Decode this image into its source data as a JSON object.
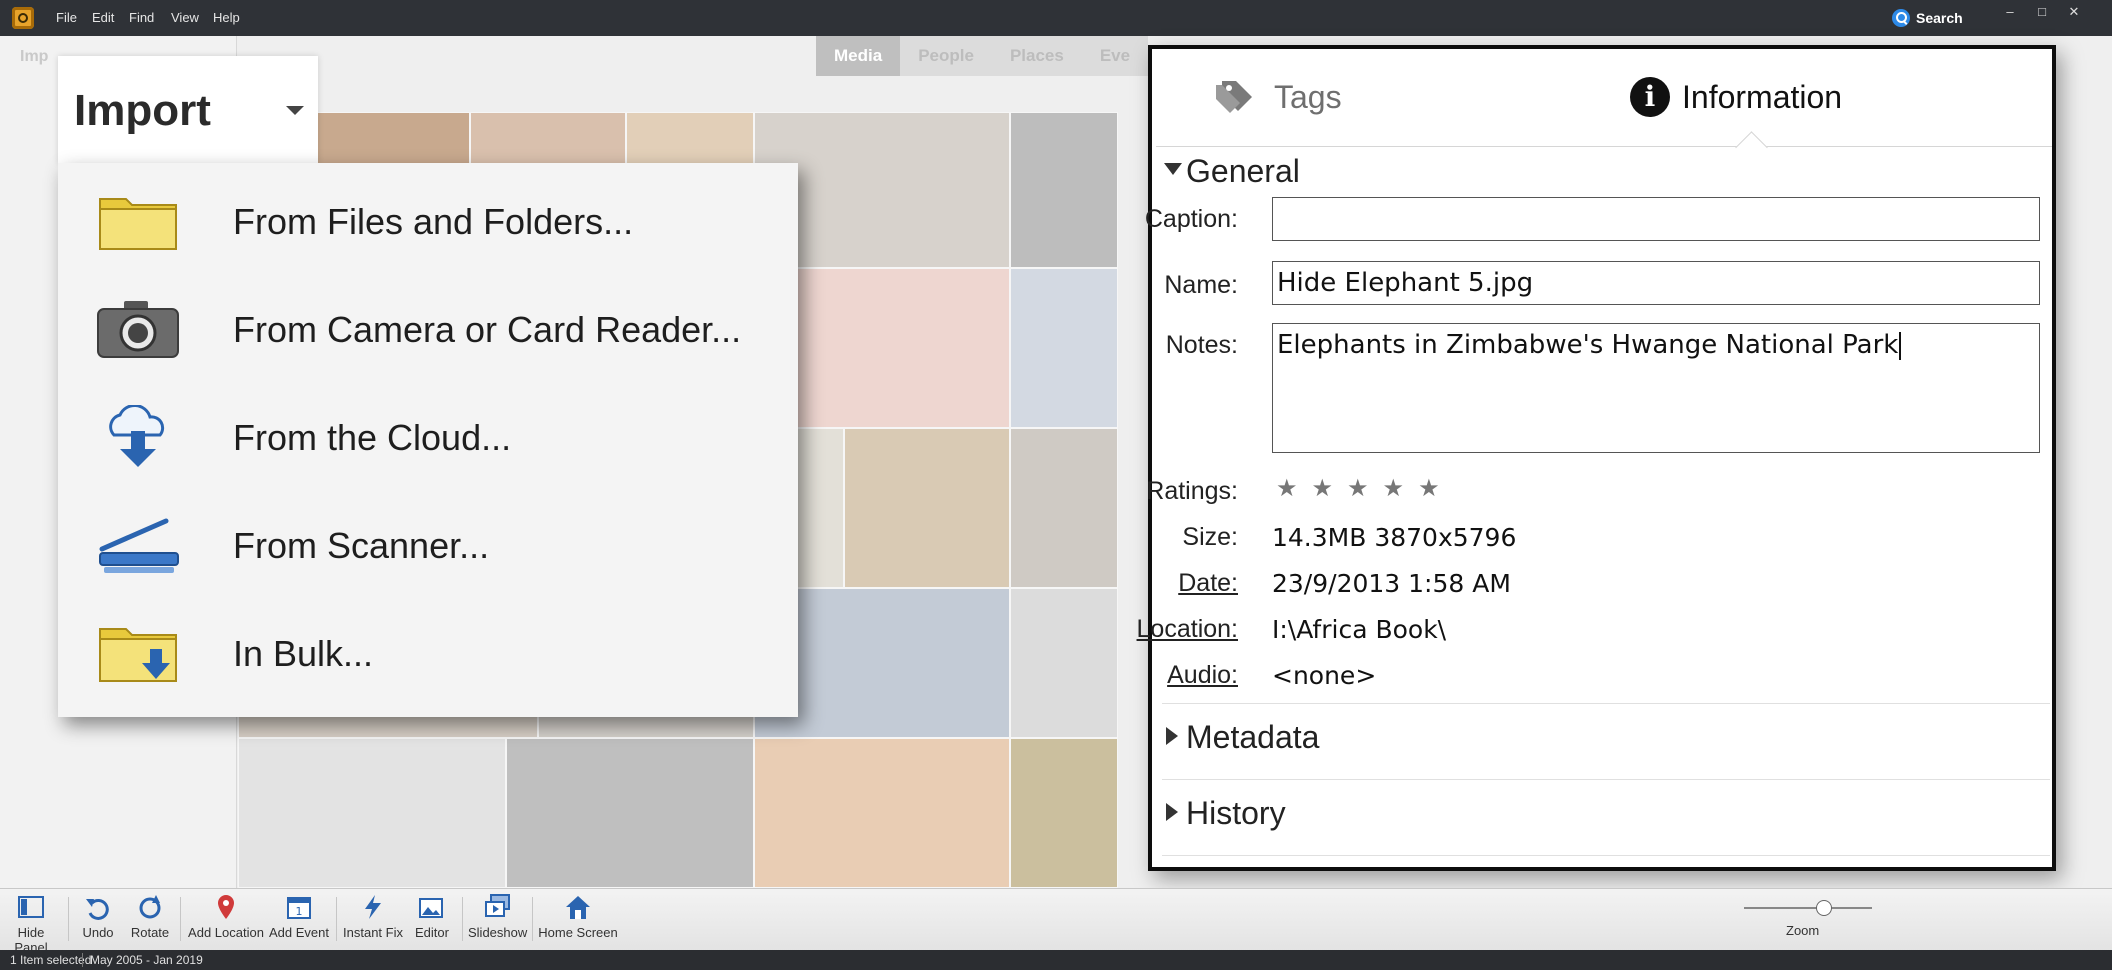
{
  "menubar": {
    "items": [
      "File",
      "Edit",
      "Find",
      "View",
      "Help"
    ],
    "search_label": "Search"
  },
  "left_panel": {
    "title": "Imp"
  },
  "view_tabs": [
    "Media",
    "People",
    "Places",
    "Eve"
  ],
  "import_menu": {
    "title": "Import",
    "items": [
      "From Files and Folders...",
      "From Camera or Card Reader...",
      "From the Cloud...",
      "From Scanner...",
      "In Bulk..."
    ]
  },
  "info_panel": {
    "tabs": {
      "tags": "Tags",
      "information": "Information"
    },
    "general": {
      "heading": "General",
      "caption_label": "Caption:",
      "caption_value": "",
      "name_label": "Name:",
      "name_value": "Hide Elephant 5.jpg",
      "notes_label": "Notes:",
      "notes_value": "Elephants in Zimbabwe's Hwange National Park",
      "ratings_label": "Ratings:",
      "rating_value": 0,
      "rating_max": 5,
      "size_label": "Size:",
      "size_value": "14.3MB  3870x5796",
      "date_label": "Date:",
      "date_value": "23/9/2013 1:58 AM",
      "location_label": "Location:",
      "location_value": "I:\\Africa Book\\",
      "audio_label": "Audio:",
      "audio_value": "<none>"
    },
    "metadata_heading": "Metadata",
    "history_heading": "History"
  },
  "toolbar": {
    "hide_panel": "Hide Panel",
    "undo": "Undo",
    "rotate": "Rotate",
    "add_location": "Add Location",
    "add_event": "Add Event",
    "instant_fix": "Instant Fix",
    "editor": "Editor",
    "slideshow": "Slideshow",
    "home_screen": "Home Screen",
    "zoom": "Zoom"
  },
  "statusbar": {
    "selection": "1 Item selected",
    "date_range": "May 2005 - Jan 2019"
  },
  "colors": {
    "menubar_bg": "#2f3237",
    "accent_blue": "#2d8ae8",
    "folder_yellow": "#f2dc55",
    "panel_border": "#0d0d0d"
  }
}
